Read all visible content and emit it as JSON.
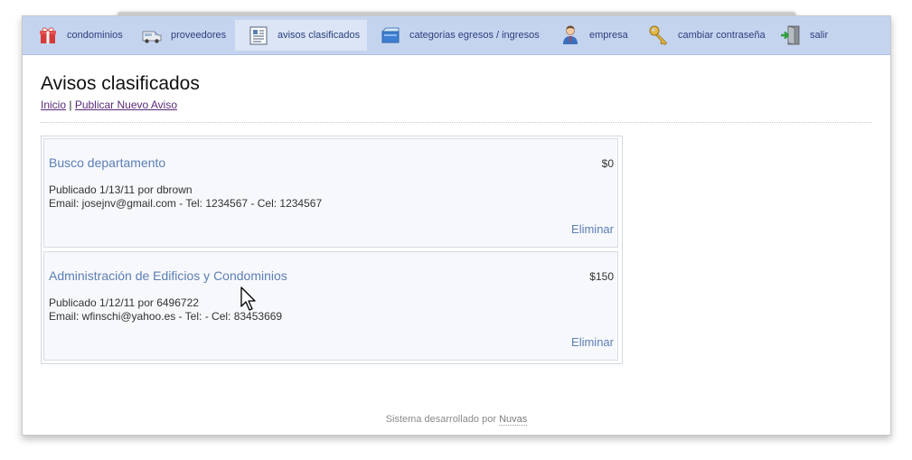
{
  "nav": {
    "items": [
      {
        "label": "condominios",
        "icon": "gift-box-icon"
      },
      {
        "label": "proveedores",
        "icon": "van-icon"
      },
      {
        "label": "avisos clasificados",
        "icon": "newspaper-icon",
        "active": true
      },
      {
        "label": "categorias egresos / ingresos",
        "icon": "cash-box-icon"
      },
      {
        "label": "empresa",
        "icon": "businessman-icon"
      },
      {
        "label": "cambiar contraseña",
        "icon": "key-icon"
      },
      {
        "label": "salir",
        "icon": "exit-door-icon"
      }
    ]
  },
  "page": {
    "title": "Avisos clasificados",
    "breadcrumb": {
      "home": "Inicio",
      "separator": "|",
      "publish": "Publicar Nuevo Aviso"
    }
  },
  "ads": [
    {
      "title": "Busco departamento",
      "price": "$0",
      "published": "Publicado 1/13/11 por dbrown",
      "contact": "Email: josejnv@gmail.com - Tel: 1234567 - Cel: 1234567",
      "delete_label": "Eliminar"
    },
    {
      "title": "Administración de Edificios y Condominios",
      "price": "$150",
      "published": "Publicado 1/12/11 por 6496722",
      "contact": "Email: wfinschi@yahoo.es - Tel: - Cel: 83453669",
      "delete_label": "Eliminar"
    }
  ],
  "footer": {
    "text": "Sistema desarrollado por",
    "link": "Nuvas"
  },
  "colors": {
    "navbar": "#c4d4ef",
    "link": "#5d7eb6",
    "nav_text": "#2b3f7c"
  }
}
